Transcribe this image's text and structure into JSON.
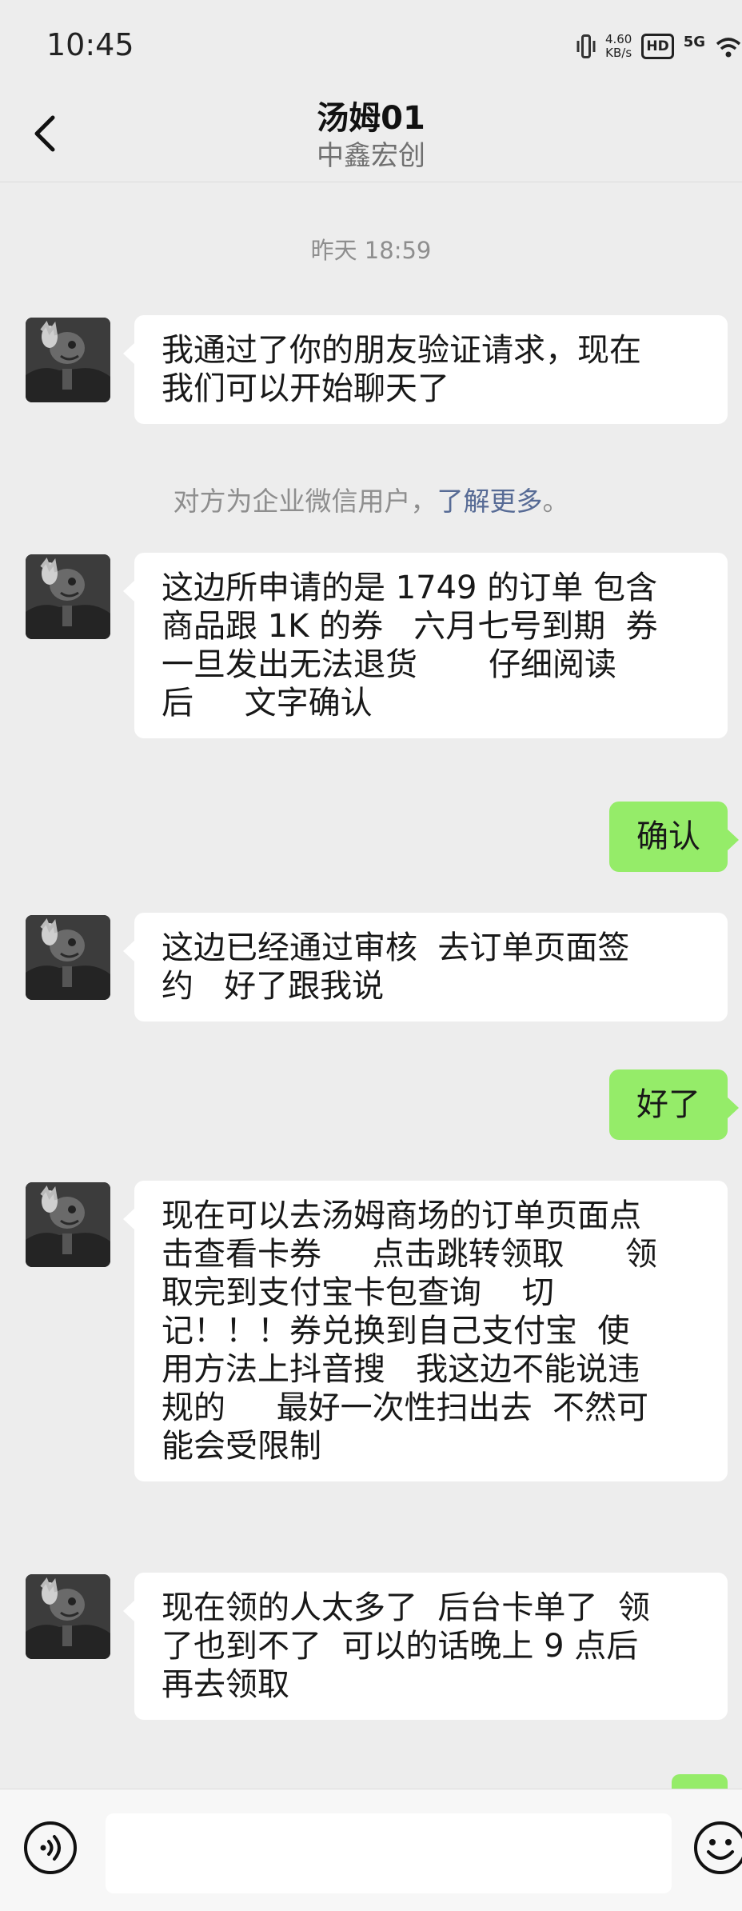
{
  "status_bar": {
    "time": "10:45",
    "net_speed_value": "4.60",
    "net_speed_unit": "KB/s",
    "hd": "HD",
    "signal": "5G"
  },
  "header": {
    "title": "汤姆01",
    "subtitle": "中鑫宏创"
  },
  "timestamp": "昨天 18:59",
  "system_notice": {
    "text": "对方为企业微信用户，",
    "link": "了解更多",
    "end": "。"
  },
  "messages": [
    {
      "from": "contact",
      "text": "我通过了你的朋友验证请求，现在\n我们可以开始聊天了"
    },
    {
      "from": "contact",
      "text": "这边所申请的是 1749 的订单 包含\n商品跟 1K 的券   六月七号到期  券\n一旦发出无法退货       仔细阅读\n后     文字确认"
    },
    {
      "from": "me",
      "text": "确认"
    },
    {
      "from": "contact",
      "text": "这边已经通过审核  去订单页面签\n约   好了跟我说"
    },
    {
      "from": "me",
      "text": "好了"
    },
    {
      "from": "contact",
      "text": "现在可以去汤姆商场的订单页面点\n击查看卡券     点击跳转领取      领\n取完到支付宝卡包查询    切\n记！！！券兑换到自己支付宝  使\n用方法上抖音搜   我这边不能说违\n规的     最好一次性扫出去  不然可\n能会受限制"
    },
    {
      "from": "contact",
      "text": "现在领的人太多了  后台卡单了  领\n了也到不了  可以的话晚上 9 点后\n再去领取"
    }
  ],
  "colors": {
    "background": "#ededed",
    "outgoing_bubble": "#95ec69",
    "incoming_bubble": "#ffffff",
    "link": "#576b95"
  },
  "icons": [
    "back-arrow-icon",
    "voice-icon",
    "emoji-icon",
    "vibrate-icon",
    "wifi-icon"
  ]
}
